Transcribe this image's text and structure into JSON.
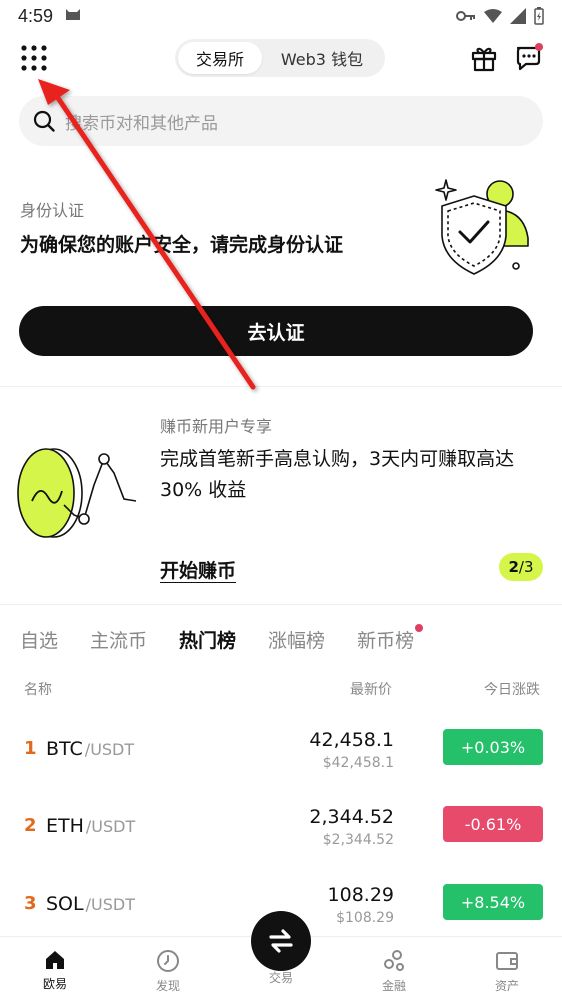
{
  "status_bar": {
    "time": "4:59"
  },
  "header": {
    "segments": [
      {
        "label": "交易所",
        "active": true
      },
      {
        "label": "Web3 钱包",
        "active": false
      }
    ],
    "icons": {
      "menu": "grid-menu-icon",
      "gift": "gift-icon",
      "message": "message-icon"
    }
  },
  "search": {
    "placeholder": "搜索币对和其他产品"
  },
  "verify_card": {
    "label": "身份认证",
    "title": "为确保您的账户安全，请完成身份认证",
    "button": "去认证"
  },
  "earn_card": {
    "label": "赚币新用户专享",
    "title": "完成首笔新手高息认购，3天内可赚取高达 30% 收益",
    "link": "开始赚币",
    "page_current": "2",
    "page_total": "/3"
  },
  "market": {
    "tabs": [
      {
        "label": "自选",
        "active": false
      },
      {
        "label": "主流币",
        "active": false
      },
      {
        "label": "热门榜",
        "active": true
      },
      {
        "label": "涨幅榜",
        "active": false
      },
      {
        "label": "新币榜",
        "active": false,
        "dot": true
      }
    ],
    "columns": {
      "name": "名称",
      "price": "最新价",
      "change": "今日涨跌"
    },
    "rows": [
      {
        "rank": "1",
        "symbol": "BTC",
        "quote": "/USDT",
        "price": "42,458.1",
        "price_usd": "$42,458.1",
        "change": "+0.03%",
        "direction": "up"
      },
      {
        "rank": "2",
        "symbol": "ETH",
        "quote": "/USDT",
        "price": "2,344.52",
        "price_usd": "$2,344.52",
        "change": "-0.61%",
        "direction": "down"
      },
      {
        "rank": "3",
        "symbol": "SOL",
        "quote": "/USDT",
        "price": "108.29",
        "price_usd": "$108.29",
        "change": "+8.54%",
        "direction": "up"
      }
    ]
  },
  "bottom_nav": {
    "items": [
      {
        "label": "欧易",
        "icon": "home-icon",
        "active": true
      },
      {
        "label": "发现",
        "icon": "discover-icon",
        "active": false
      },
      {
        "label": "交易",
        "icon": "swap-icon",
        "active": false
      },
      {
        "label": "金融",
        "icon": "finance-icon",
        "active": false
      },
      {
        "label": "资产",
        "icon": "wallet-icon",
        "active": false
      }
    ]
  },
  "colors": {
    "accent_lime": "#d6f54a",
    "up": "#24c06a",
    "down": "#e84a6c",
    "rank": "#e06a1a",
    "annotation": "#e8201c"
  }
}
